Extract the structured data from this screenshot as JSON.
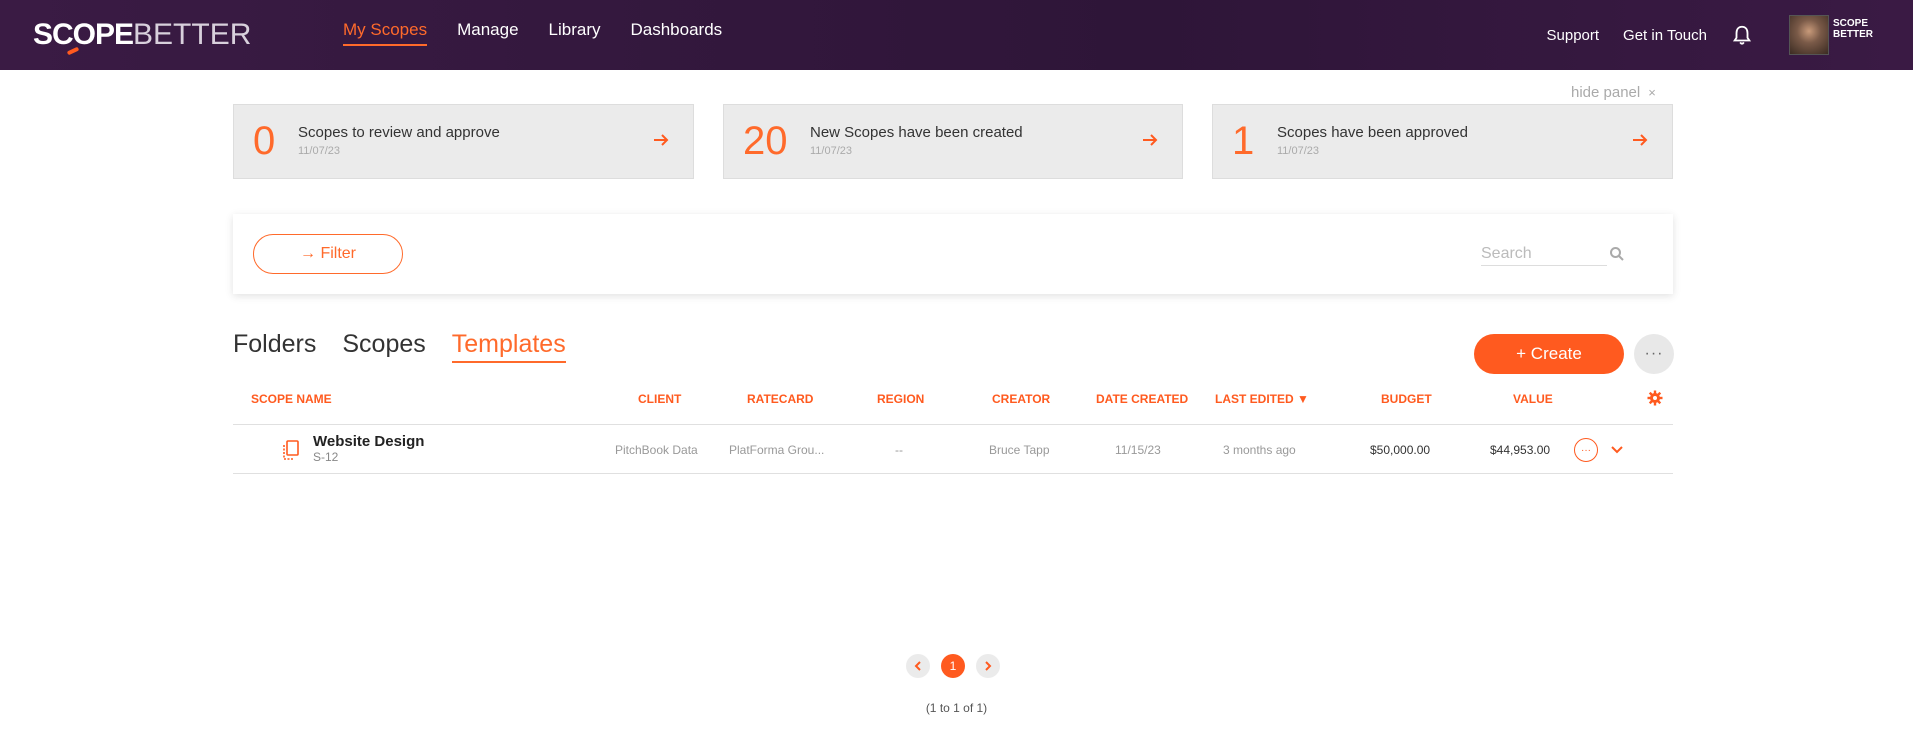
{
  "brand": {
    "logo_part1": "SCOPE",
    "logo_part2": "BETTER",
    "mini_logo": "SCOPE BETTER"
  },
  "nav": {
    "items": [
      {
        "label": "My Scopes",
        "active": true
      },
      {
        "label": "Manage"
      },
      {
        "label": "Library"
      },
      {
        "label": "Dashboards"
      }
    ],
    "support": "Support",
    "contact": "Get in Touch"
  },
  "panel": {
    "hide_label": "hide panel",
    "hide_icon": "×",
    "cards": [
      {
        "count": "0",
        "label": "Scopes to review and approve",
        "date": "11/07/23"
      },
      {
        "count": "20",
        "label": "New Scopes have been created",
        "date": "11/07/23"
      },
      {
        "count": "1",
        "label": "Scopes have been approved",
        "date": "11/07/23"
      }
    ]
  },
  "filter": {
    "label": "→ Filter",
    "search_placeholder": "Search"
  },
  "tabs": [
    {
      "label": "Folders"
    },
    {
      "label": "Scopes"
    },
    {
      "label": "Templates",
      "active": true
    }
  ],
  "actions": {
    "create": "+ Create",
    "more": "···"
  },
  "table": {
    "headers": [
      "SCOPE NAME",
      "CLIENT",
      "RATECARD",
      "REGION",
      "CREATOR",
      "DATE CREATED",
      "LAST EDITED ▼",
      "BUDGET",
      "VALUE"
    ],
    "rows": [
      {
        "name": "Website Design",
        "code": "S-12",
        "client": "PitchBook Data",
        "ratecard": "PlatForma Grou...",
        "region": "--",
        "creator": "Bruce Tapp",
        "date_created": "11/15/23",
        "last_edited": "3 months ago",
        "budget": "$50,000.00",
        "value": "$44,953.00"
      }
    ]
  },
  "pagination": {
    "current": "1",
    "status": "(1 to 1 of 1)"
  },
  "colors": {
    "accent": "#ff5a1f",
    "header_bg": "#2e1538"
  }
}
